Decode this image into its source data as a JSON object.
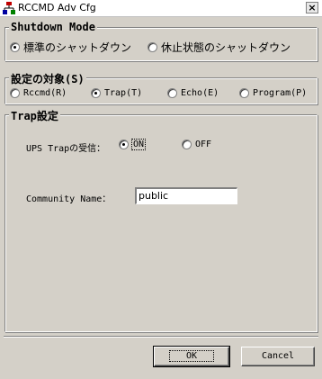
{
  "window": {
    "title": "RCCMD Adv Cfg",
    "close_label": "×"
  },
  "shutdown_mode": {
    "legend": "Shutdown Mode",
    "options": [
      {
        "label": "標準のシャットダウン",
        "checked": true
      },
      {
        "label": "休止状態のシャットダウン",
        "checked": false
      }
    ]
  },
  "target": {
    "legend": "設定の対象(S)",
    "options": [
      {
        "label": "Rccmd(R)",
        "checked": false
      },
      {
        "label": "Trap(T)",
        "checked": true
      },
      {
        "label": "Echo(E)",
        "checked": false
      },
      {
        "label": "Program(P)",
        "checked": false
      }
    ]
  },
  "trap": {
    "legend": "Trap設定",
    "receive_label": "UPS Trapの受信：",
    "on_label": "ON",
    "off_label": "OFF",
    "on_checked": true,
    "community_label": "Community Name：",
    "community_value": "public"
  },
  "buttons": {
    "ok": "OK",
    "cancel": "Cancel"
  },
  "colors": {
    "face": "#d4d0c8",
    "shadow": "#808080",
    "highlight": "#ffffff"
  }
}
